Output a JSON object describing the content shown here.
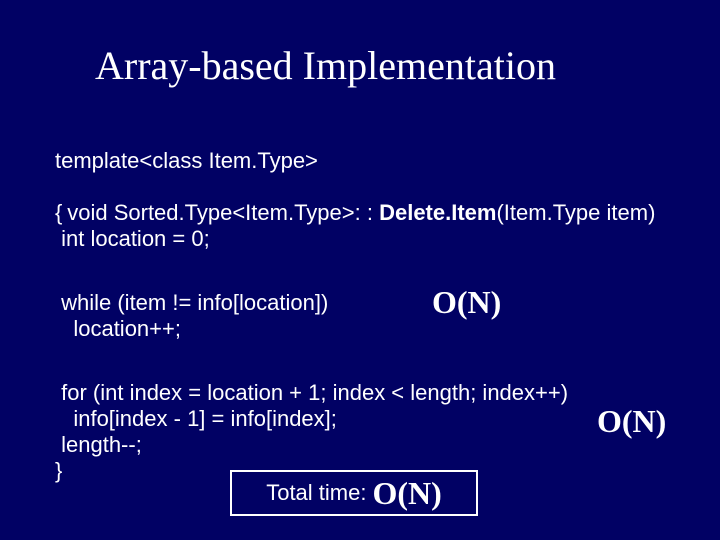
{
  "title": "Array-based Implementation",
  "code": {
    "l1": "template<class Item.Type>",
    "l2a": "void Sorted.Type<Item.Type>: : ",
    "l2b": "Delete.Item",
    "l2c": "(Item.Type item)",
    "l3": "{",
    "l4": " int location = 0;",
    "l5": " while (item != info[location])",
    "l6": "   location++;",
    "l7": " for (int index = location + 1; index < length; index++)",
    "l8": "   info[index - 1] = info[index];",
    "l9": " length--;",
    "l10": "}"
  },
  "annot": {
    "a1": "O(N)",
    "a2": "O(N)",
    "total_label": "Total time: ",
    "total_value": "O(N)"
  }
}
